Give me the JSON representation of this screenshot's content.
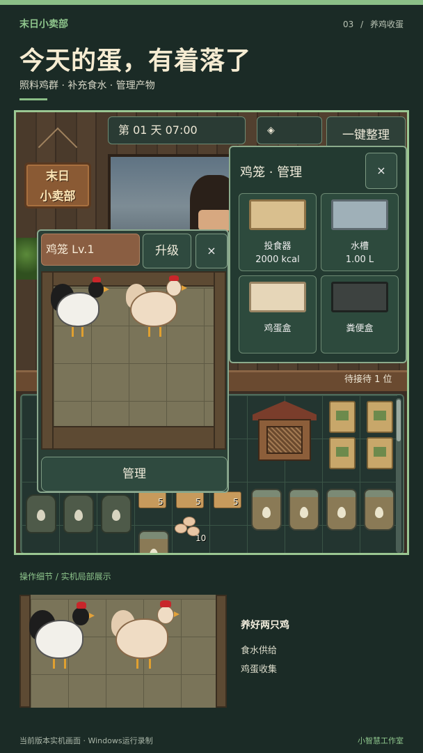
{
  "header": {
    "brand": "末日小卖部",
    "page_num": "03",
    "page_sep": "/",
    "page_name": "养鸡收蛋",
    "title": "今天的蛋，有着落了",
    "subtitle": "照料鸡群 · 补充食水 · 管理产物"
  },
  "game": {
    "sign_line1": "末日",
    "sign_line2": "小卖部",
    "time_label": "第 01 天  07:00",
    "diamond_icon": "◈",
    "organize_button": "一键整理",
    "waiting_text": "待接待 1 位",
    "management_panel": {
      "title": "鸡笼 · 管理",
      "close": "×",
      "slots": [
        {
          "name": "投食器",
          "value": "2000 kcal",
          "color": "#d9bf8e"
        },
        {
          "name": "水槽",
          "value": "1.00 L",
          "color": "#9fb0b8"
        },
        {
          "name": "鸡蛋盒",
          "value": "",
          "color": "#e6d6b8"
        },
        {
          "name": "粪便盒",
          "value": "",
          "color": "#3d4240"
        }
      ]
    },
    "coop_panel": {
      "name": "鸡笼 Lv.1",
      "upgrade": "升级",
      "close": "×",
      "manage": "管理"
    },
    "inventory": {
      "feed_counts": [
        "5",
        "5",
        "5"
      ],
      "egg_count": "10"
    }
  },
  "detail": {
    "caption": "操作细节 / 实机局部展示",
    "title": "养好两只鸡",
    "line1": "食水供给",
    "line2": "鸡蛋收集"
  },
  "footer": {
    "left": "当前版本实机画面 · Windows运行录制",
    "right": "小智慧工作室"
  },
  "colors": {
    "background": "#1b2b26",
    "accent": "#8ec58c",
    "panel": "#233a31"
  }
}
